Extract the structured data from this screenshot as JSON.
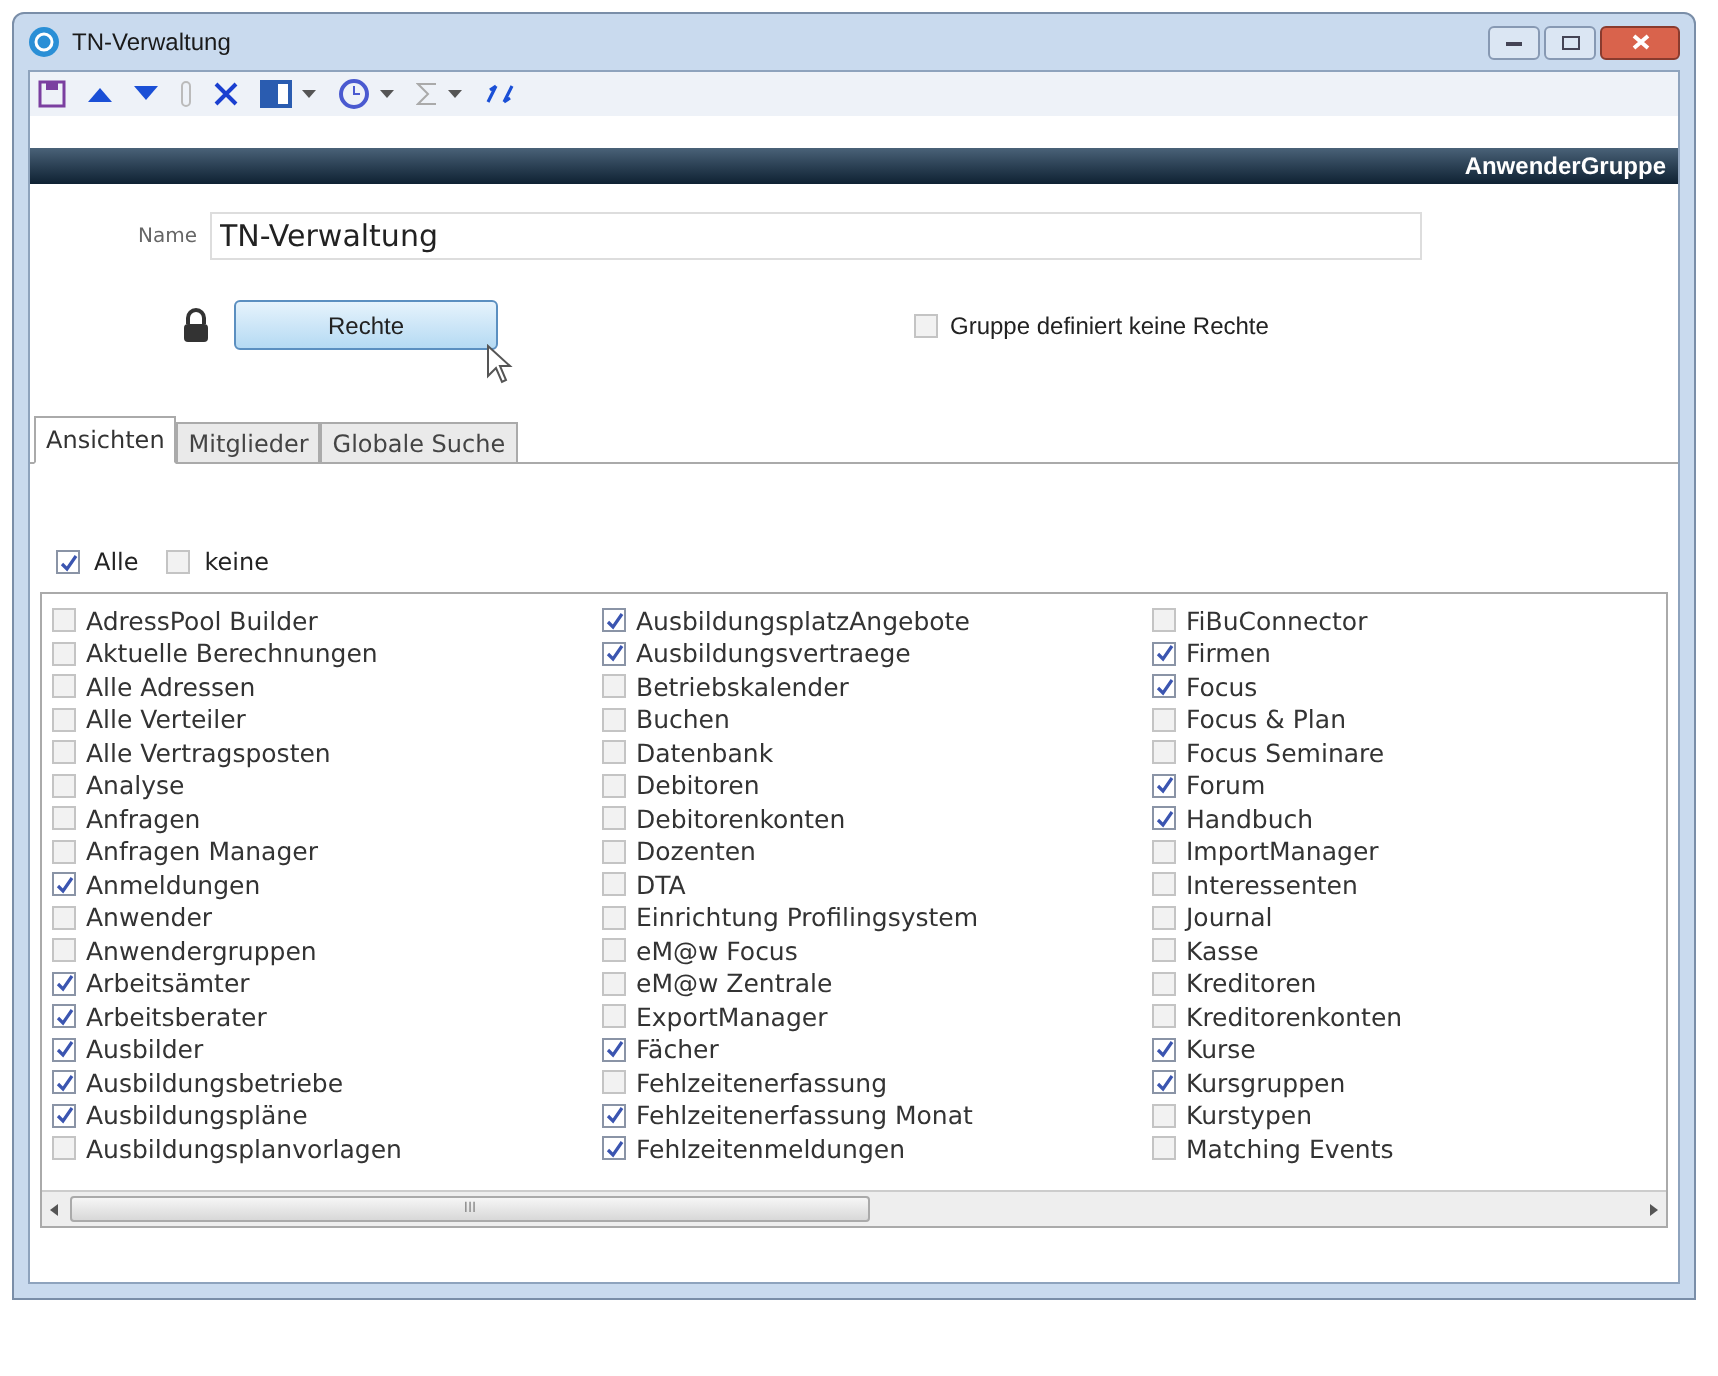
{
  "window": {
    "title": "TN-Verwaltung"
  },
  "header": {
    "title": "AnwenderGruppe"
  },
  "name_field": {
    "label": "Name",
    "value": "TN-Verwaltung"
  },
  "rights_button": {
    "label": "Rechte"
  },
  "no_rights_checkbox": {
    "label": "Gruppe definiert keine Rechte",
    "checked": false
  },
  "tabs": [
    {
      "label": "Ansichten",
      "selected": true
    },
    {
      "label": "Mitglieder",
      "selected": false
    },
    {
      "label": "Globale Suche",
      "selected": false
    }
  ],
  "select_options": [
    {
      "label": "Alle",
      "checked": true
    },
    {
      "label": "keine",
      "checked": false
    }
  ],
  "view_columns": [
    [
      {
        "label": "AdressPool Builder",
        "checked": false
      },
      {
        "label": "Aktuelle Berechnungen",
        "checked": false
      },
      {
        "label": "Alle Adressen",
        "checked": false
      },
      {
        "label": "Alle Verteiler",
        "checked": false
      },
      {
        "label": "Alle Vertragsposten",
        "checked": false
      },
      {
        "label": "Analyse",
        "checked": false
      },
      {
        "label": "Anfragen",
        "checked": false
      },
      {
        "label": "Anfragen Manager",
        "checked": false
      },
      {
        "label": "Anmeldungen",
        "checked": true
      },
      {
        "label": "Anwender",
        "checked": false
      },
      {
        "label": "Anwendergruppen",
        "checked": false
      },
      {
        "label": "Arbeitsämter",
        "checked": true
      },
      {
        "label": "Arbeitsberater",
        "checked": true
      },
      {
        "label": "Ausbilder",
        "checked": true
      },
      {
        "label": "Ausbildungsbetriebe",
        "checked": true
      },
      {
        "label": "Ausbildungspläne",
        "checked": true
      },
      {
        "label": "Ausbildungsplanvorlagen",
        "checked": false
      }
    ],
    [
      {
        "label": "AusbildungsplatzAngebote",
        "checked": true
      },
      {
        "label": "Ausbildungsvertraege",
        "checked": true
      },
      {
        "label": "Betriebskalender",
        "checked": false
      },
      {
        "label": "Buchen",
        "checked": false
      },
      {
        "label": "Datenbank",
        "checked": false
      },
      {
        "label": "Debitoren",
        "checked": false
      },
      {
        "label": "Debitorenkonten",
        "checked": false
      },
      {
        "label": "Dozenten",
        "checked": false
      },
      {
        "label": "DTA",
        "checked": false
      },
      {
        "label": "Einrichtung Profilingsystem",
        "checked": false
      },
      {
        "label": "eM@w Focus",
        "checked": false
      },
      {
        "label": "eM@w Zentrale",
        "checked": false
      },
      {
        "label": "ExportManager",
        "checked": false
      },
      {
        "label": "Fächer",
        "checked": true
      },
      {
        "label": "Fehlzeitenerfassung",
        "checked": false
      },
      {
        "label": "Fehlzeitenerfassung Monat",
        "checked": true
      },
      {
        "label": "Fehlzeitenmeldungen",
        "checked": true
      }
    ],
    [
      {
        "label": "FiBuConnector",
        "checked": false
      },
      {
        "label": "Firmen",
        "checked": true
      },
      {
        "label": "Focus",
        "checked": true
      },
      {
        "label": "Focus & Plan",
        "checked": false
      },
      {
        "label": "Focus Seminare",
        "checked": false
      },
      {
        "label": "Forum",
        "checked": true
      },
      {
        "label": "Handbuch",
        "checked": true
      },
      {
        "label": "ImportManager",
        "checked": false
      },
      {
        "label": "Interessenten",
        "checked": false
      },
      {
        "label": "Journal",
        "checked": false
      },
      {
        "label": "Kasse",
        "checked": false
      },
      {
        "label": "Kreditoren",
        "checked": false
      },
      {
        "label": "Kreditorenkonten",
        "checked": false
      },
      {
        "label": "Kurse",
        "checked": true
      },
      {
        "label": "Kursgruppen",
        "checked": true
      },
      {
        "label": "Kurstypen",
        "checked": false
      },
      {
        "label": "Matching Events",
        "checked": false
      }
    ]
  ],
  "scrollbar": {
    "grip": "III"
  }
}
